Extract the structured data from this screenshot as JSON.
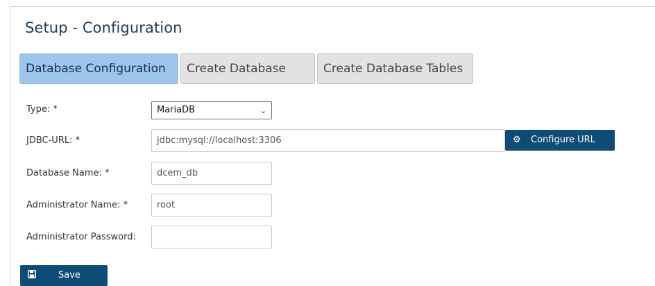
{
  "page": {
    "title": "Setup - Configuration"
  },
  "tabs": [
    {
      "label": "Database Configuration",
      "active": true
    },
    {
      "label": "Create Database",
      "active": false
    },
    {
      "label": "Create Database Tables",
      "active": false
    }
  ],
  "form": {
    "type": {
      "label": "Type:  *",
      "value": "MariaDB"
    },
    "jdbc_url": {
      "label": "JDBC-URL:  *",
      "value": "jdbc:mysql://localhost:3306"
    },
    "db_name": {
      "label": "Database Name:  *",
      "value": "dcem_db"
    },
    "admin_name": {
      "label": "Administrator Name:  *",
      "value": "root"
    },
    "admin_password": {
      "label": "Administrator Password:",
      "value": ""
    }
  },
  "buttons": {
    "configure_url": "Configure URL",
    "save": "Save"
  },
  "icons": {
    "configure_url": "gear-icon",
    "save": "floppy-disk-icon",
    "select": "chevron-down-icon"
  },
  "colors": {
    "active_tab": "#9ec5ec",
    "inactive_tab": "#e2e2e2",
    "button": "#0f4c75",
    "title": "#1f3a5a"
  }
}
